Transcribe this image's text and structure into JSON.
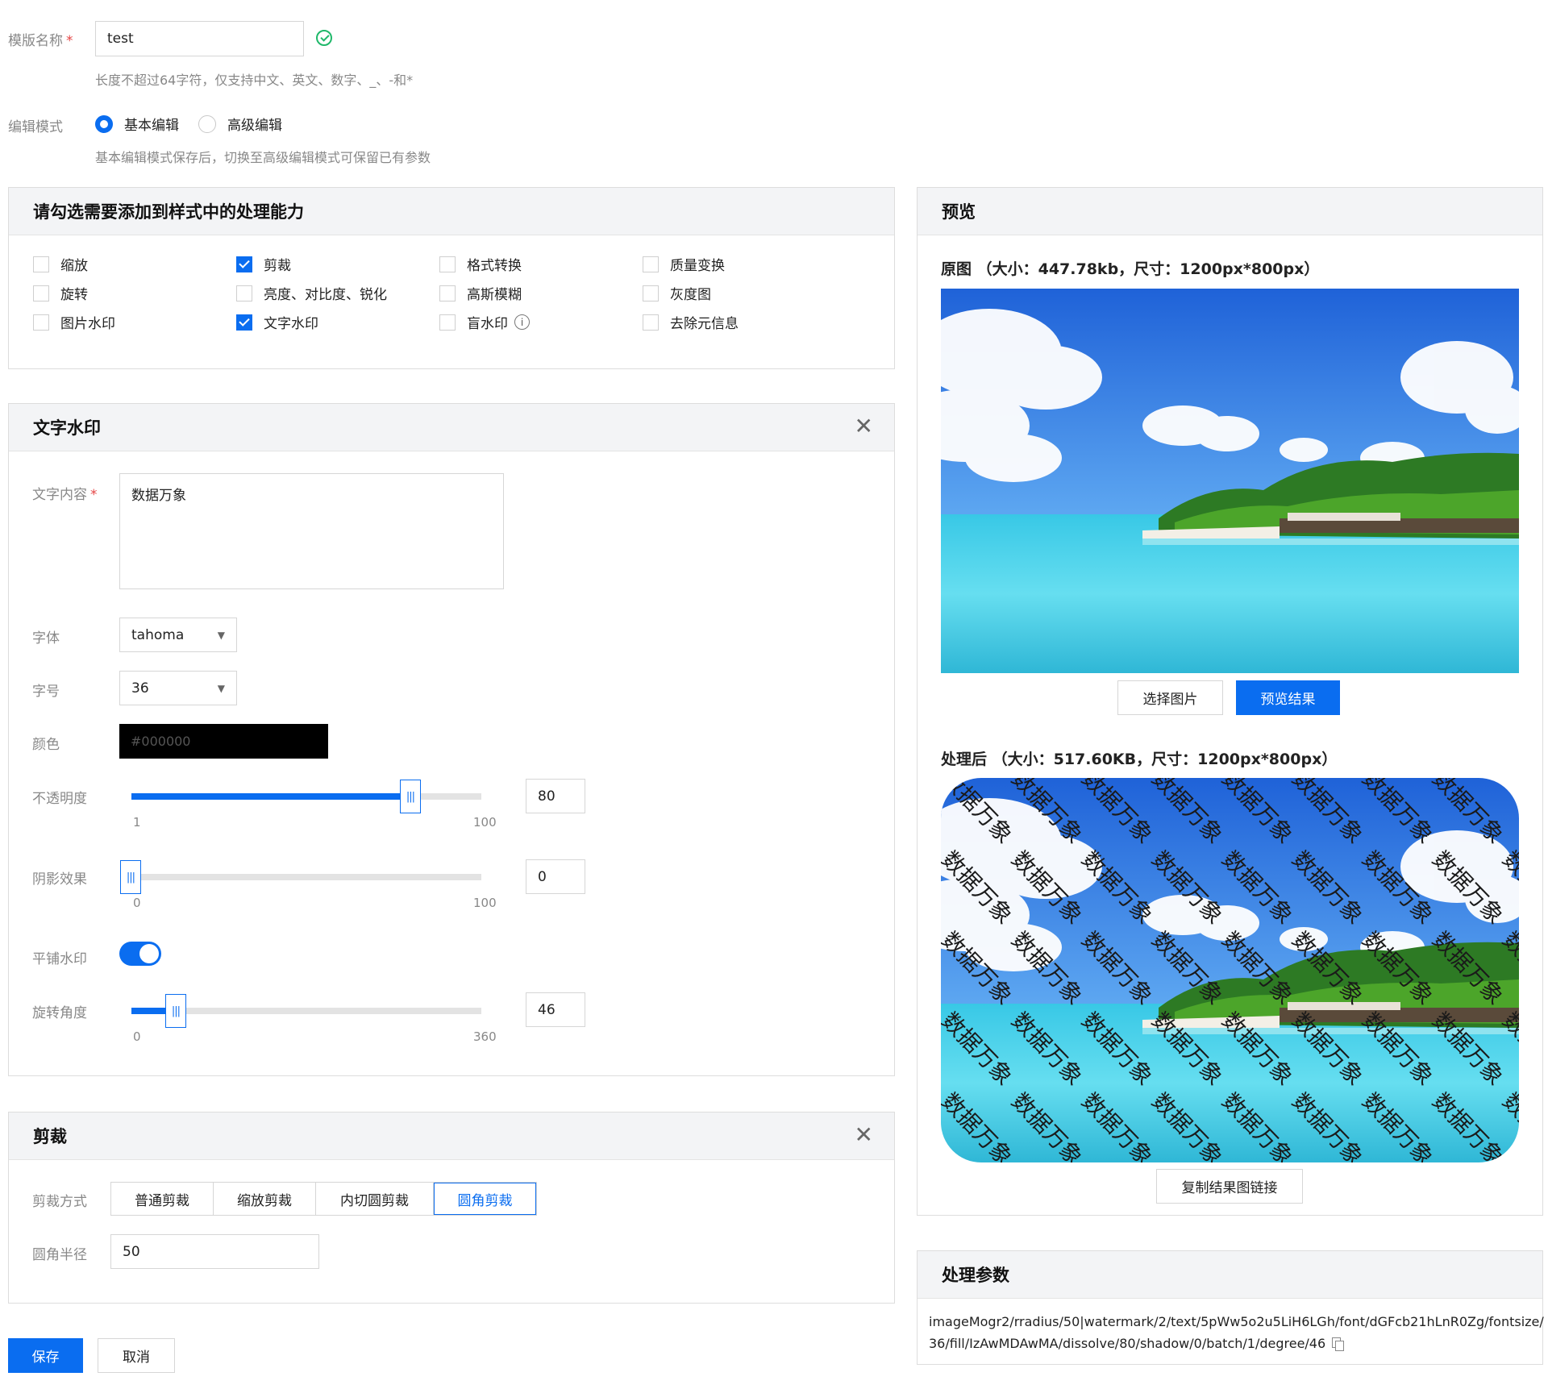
{
  "template": {
    "name_label": "模版名称",
    "required_mark": "*",
    "name_value": "test",
    "name_hint": "长度不超过64字符，仅支持中文、英文、数字、_、-和*",
    "mode_label": "编辑模式",
    "mode_options": [
      "基本编辑",
      "高级编辑"
    ],
    "mode_selected": "基本编辑",
    "mode_hint": "基本编辑模式保存后，切换至高级编辑模式可保留已有参数"
  },
  "capabilities": {
    "title": "请勾选需要添加到样式中的处理能力",
    "items": [
      {
        "label": "缩放",
        "checked": false
      },
      {
        "label": "剪裁",
        "checked": true
      },
      {
        "label": "格式转换",
        "checked": false
      },
      {
        "label": "质量变换",
        "checked": false
      },
      {
        "label": "旋转",
        "checked": false
      },
      {
        "label": "亮度、对比度、锐化",
        "checked": false
      },
      {
        "label": "高斯模糊",
        "checked": false
      },
      {
        "label": "灰度图",
        "checked": false
      },
      {
        "label": "图片水印",
        "checked": false
      },
      {
        "label": "文字水印",
        "checked": true
      },
      {
        "label": "盲水印",
        "checked": false
      },
      {
        "label": "去除元信息",
        "checked": false
      }
    ]
  },
  "watermark": {
    "title": "文字水印",
    "text_label": "文字内容",
    "text_value": "数据万象",
    "font_label": "字体",
    "font_value": "tahoma",
    "size_label": "字号",
    "size_value": "36",
    "color_label": "颜色",
    "color_value": "#000000",
    "opacity_label": "不透明度",
    "opacity_value": "80",
    "opacity_min": "1",
    "opacity_max": "100",
    "shadow_label": "阴影效果",
    "shadow_value": "0",
    "shadow_min": "0",
    "shadow_max": "100",
    "tile_label": "平铺水印",
    "tile_on": true,
    "rotate_label": "旋转角度",
    "rotate_value": "46",
    "rotate_min": "0",
    "rotate_max": "360"
  },
  "crop": {
    "title": "剪裁",
    "mode_label": "剪裁方式",
    "modes": [
      "普通剪裁",
      "缩放剪裁",
      "内切圆剪裁",
      "圆角剪裁"
    ],
    "selected": "圆角剪裁",
    "radius_label": "圆角半径",
    "radius_value": "50"
  },
  "actions": {
    "save": "保存",
    "cancel": "取消"
  },
  "preview": {
    "title": "预览",
    "original_caption": "原图 （大小：447.78kb，尺寸：1200px*800px）",
    "select_image": "选择图片",
    "preview_result": "预览结果",
    "processed_caption": "处理后 （大小：517.60KB，尺寸：1200px*800px）",
    "copy_link": "复制结果图链接"
  },
  "params": {
    "title": "处理参数",
    "line1": "imageMogr2/rradius/50|watermark/2/text/5pWw5o2u5LiH6LGh/font/dGFcb21hLnR0Zg/fontsize/",
    "line2": "36/fill/IzAwMDAwMA/dissolve/80/shadow/0/batch/1/degree/46"
  },
  "colors": {
    "accent": "#0a6df0",
    "header_bg": "#f3f4f6",
    "success": "#1fb86a"
  }
}
